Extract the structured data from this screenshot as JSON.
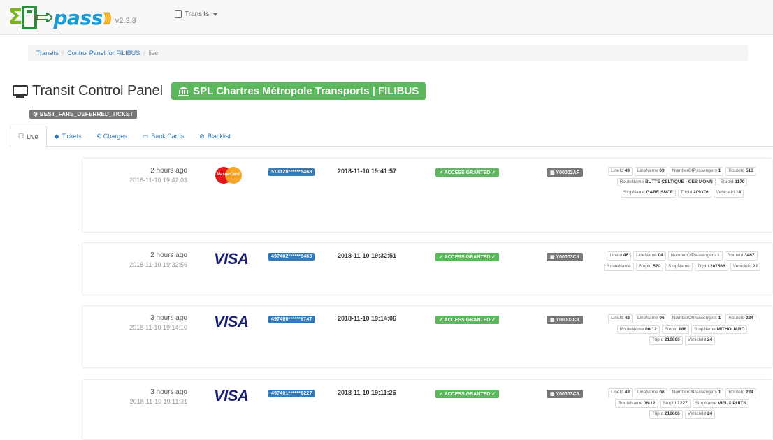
{
  "brand": {
    "name": "pass",
    "version": "v2.3.3"
  },
  "nav": {
    "dropdown_label": "Transits"
  },
  "breadcrumb": {
    "items": [
      "Transits",
      "Control Panel for FILIBUS"
    ],
    "active": "live"
  },
  "header": {
    "title": "Transit Control Panel",
    "operator": "SPL Chartres Métropole Transports | FILIBUS",
    "fare_label": "BEST_FARE_DEFERRED_TICKET"
  },
  "tabs": [
    {
      "label": "Live",
      "icon": "calendar-icon",
      "active": true
    },
    {
      "label": "Tickets",
      "icon": "tag-icon",
      "active": false
    },
    {
      "label": "Charges",
      "icon": "euro-icon",
      "active": false
    },
    {
      "label": "Bank Cards",
      "icon": "credit-card-icon",
      "active": false
    },
    {
      "label": "Blacklist",
      "icon": "ban-icon",
      "active": false
    }
  ],
  "colors": {
    "green": "#5cb85c",
    "blue": "#337ab7",
    "grey": "#777777",
    "visa_blue": "#1a1f71",
    "mc_red": "#e8161b",
    "mc_orange": "#f7a21b"
  },
  "transits": [
    {
      "relative": "2 hours ago",
      "absolute": "2018-11-10 19:42:03",
      "card_brand": "mastercard",
      "card_brand_text": "MasterCard",
      "pan": "513128******5468",
      "tap_time": "2018-11-10 19:41:57",
      "access": "ACCESS GRANTED",
      "device": "Y00002AF",
      "attrs": [
        [
          "LineId",
          "49"
        ],
        [
          "LineName",
          "03"
        ],
        [
          "NumberOfPassengers",
          "1"
        ],
        [
          "RouteId",
          "513"
        ],
        [
          "RouteName",
          "BUTTE CELTIQUE - CES MONN"
        ],
        [
          "StopId",
          "1170"
        ],
        [
          "StopName",
          "GARE SNCF"
        ],
        [
          "TripId",
          "209376"
        ],
        [
          "VehicleId",
          "14"
        ]
      ]
    },
    {
      "relative": "2 hours ago",
      "absolute": "2018-11-10 19:32:56",
      "card_brand": "visa",
      "card_brand_text": "VISA",
      "pan": "497402******0468",
      "tap_time": "2018-11-10 19:32:51",
      "access": "ACCESS GRANTED",
      "device": "Y00003C8",
      "attrs": [
        [
          "LineId",
          "46"
        ],
        [
          "LineName",
          "04"
        ],
        [
          "NumberOfPassengers",
          "1"
        ],
        [
          "RouteId",
          "3467"
        ],
        [
          "RouteName",
          ""
        ],
        [
          "StopId",
          "520"
        ],
        [
          "StopName",
          ""
        ],
        [
          "TripId",
          "207566"
        ],
        [
          "VehicleId",
          "22"
        ]
      ]
    },
    {
      "relative": "3 hours ago",
      "absolute": "2018-11-10 19:14:10",
      "card_brand": "visa",
      "card_brand_text": "VISA",
      "pan": "497400******9747",
      "tap_time": "2018-11-10 19:14:06",
      "access": "ACCESS GRANTED",
      "device": "Y00003C8",
      "attrs": [
        [
          "LineId",
          "48"
        ],
        [
          "LineName",
          "06"
        ],
        [
          "NumberOfPassengers",
          "1"
        ],
        [
          "RouteId",
          "224"
        ],
        [
          "RouteName",
          "06-12"
        ],
        [
          "StopId",
          "886"
        ],
        [
          "StopName",
          "MITHOUARD"
        ],
        [
          "TripId",
          "210866"
        ],
        [
          "VehicleId",
          "24"
        ]
      ]
    },
    {
      "relative": "3 hours ago",
      "absolute": "2018-11-10 19:11:31",
      "card_brand": "visa",
      "card_brand_text": "VISA",
      "pan": "497401******9227",
      "tap_time": "2018-11-10 19:11:26",
      "access": "ACCESS GRANTED",
      "device": "Y00003C8",
      "attrs": [
        [
          "LineId",
          "48"
        ],
        [
          "LineName",
          "06"
        ],
        [
          "NumberOfPassengers",
          "1"
        ],
        [
          "RouteId",
          "224"
        ],
        [
          "RouteName",
          "06-12"
        ],
        [
          "StopId",
          "1227"
        ],
        [
          "StopName",
          "VIEUX PUITS"
        ],
        [
          "TripId",
          "210866"
        ],
        [
          "VehicleId",
          "24"
        ]
      ]
    }
  ]
}
